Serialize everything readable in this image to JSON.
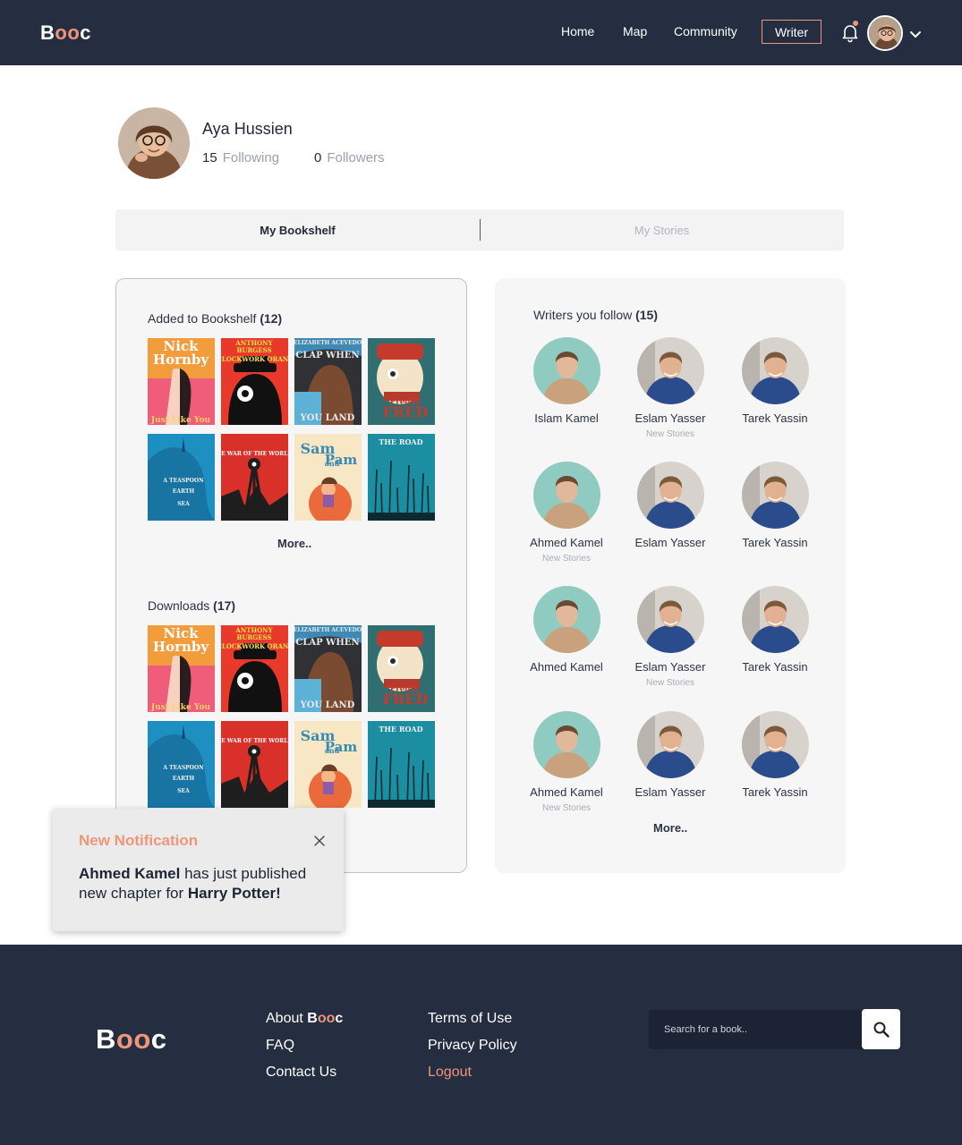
{
  "header": {
    "logo": {
      "pre": "B",
      "accent": "oo",
      "post": "c"
    },
    "nav": [
      "Home",
      "Map",
      "Community"
    ],
    "writer_button": "Writer"
  },
  "profile": {
    "name": "Aya Hussien",
    "following_count": "15",
    "following_label": "Following",
    "followers_count": "0",
    "followers_label": "Followers"
  },
  "tabs": {
    "active": "My Bookshelf",
    "inactive": "My Stories"
  },
  "bookshelf": {
    "title": "Added to Bookshelf",
    "count": "(12)",
    "more": "More..",
    "books": [
      {
        "l1": "Nick",
        "l2": "Hornby",
        "l3": "Just Like You"
      },
      {
        "l1": "ANTHONY",
        "l2": "BURGESS",
        "l3": "A CLOCKWORK ORANGE"
      },
      {
        "l1": "ELIZABETH ACEVEDO",
        "l2": "CLAP WHEN",
        "l3": "YOU LAND"
      },
      {
        "l1": "Freddy",
        "l2": "FRED"
      },
      {
        "l1": "A TEASPOON",
        "l2": "EARTH",
        "l3": "SEA"
      },
      {
        "l1": "THE WAR OF THE WORLDS"
      },
      {
        "l1": "Sam",
        "l2": "and",
        "l3": "Pam"
      },
      {
        "l1": "THE ROAD"
      }
    ]
  },
  "downloads": {
    "title": "Downloads",
    "count": "(17)"
  },
  "writers": {
    "title": "Writers you follow",
    "count": "(15)",
    "more": "More..",
    "list": [
      {
        "name": "Islam Kamel",
        "sub": ""
      },
      {
        "name": "Eslam Yasser",
        "sub": "New Stories"
      },
      {
        "name": "Tarek Yassin",
        "sub": ""
      },
      {
        "name": "Ahmed Kamel",
        "sub": "New Stories"
      },
      {
        "name": "Eslam Yasser",
        "sub": ""
      },
      {
        "name": "Tarek Yassin",
        "sub": ""
      },
      {
        "name": "Ahmed Kamel",
        "sub": ""
      },
      {
        "name": "Eslam Yasser",
        "sub": "New Stories"
      },
      {
        "name": "Tarek Yassin",
        "sub": ""
      },
      {
        "name": "Ahmed Kamel",
        "sub": "New Stories"
      },
      {
        "name": "Eslam Yasser",
        "sub": ""
      },
      {
        "name": "Tarek Yassin",
        "sub": ""
      }
    ]
  },
  "notification": {
    "title": "New Notification",
    "author": "Ahmed Kamel",
    "text1": " has just published new chapter for ",
    "book": "Harry Potter!"
  },
  "footer": {
    "about_pre": "About ",
    "about_brand_pre": "B",
    "about_brand_accent": "oo",
    "about_brand_post": "c",
    "faq": "FAQ",
    "contact": "Contact Us",
    "terms": "Terms of Use",
    "privacy": "Privacy Policy",
    "logout": "Logout",
    "search_placeholder": "Search for a book.."
  },
  "colors": {
    "navy": "#252d40",
    "accent": "#f0957a",
    "card": "#f6f6f6"
  },
  "icons": [
    "bell-icon",
    "chevron-down-icon",
    "close-icon",
    "search-icon"
  ]
}
